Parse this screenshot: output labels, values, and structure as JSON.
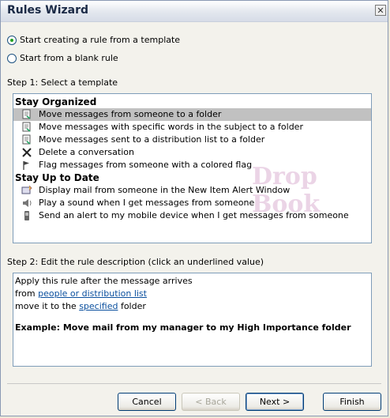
{
  "window": {
    "title": "Rules Wizard",
    "close_glyph": "✕"
  },
  "options": [
    {
      "label": "Start creating a rule from a template",
      "selected": true
    },
    {
      "label": "Start from a blank rule",
      "selected": false
    }
  ],
  "step1": {
    "label": "Step 1: Select a template",
    "groups": [
      {
        "title": "Stay Organized",
        "items": [
          {
            "label": "Move messages from someone to a folder",
            "icon": "folder-move-icon",
            "selected": true
          },
          {
            "label": "Move messages with specific words in the subject to a folder",
            "icon": "folder-move-icon"
          },
          {
            "label": "Move messages sent to a distribution list to a folder",
            "icon": "folder-move-icon"
          },
          {
            "label": "Delete a conversation",
            "icon": "delete-x-icon"
          },
          {
            "label": "Flag messages from someone with a colored flag",
            "icon": "flag-icon"
          }
        ]
      },
      {
        "title": "Stay Up to Date",
        "items": [
          {
            "label": "Display mail from someone in the New Item Alert Window",
            "icon": "alert-window-icon"
          },
          {
            "label": "Play a sound when I get messages from someone",
            "icon": "speaker-icon"
          },
          {
            "label": "Send an alert to my mobile device when I get messages from someone",
            "icon": "mobile-device-icon"
          }
        ]
      }
    ]
  },
  "step2": {
    "label": "Step 2: Edit the rule description (click an underlined value)",
    "line1": "Apply this rule after the message arrives",
    "line2_prefix": "from ",
    "line2_link": "people or distribution list",
    "line3_prefix": "move it to the ",
    "line3_link": "specified",
    "line3_suffix": " folder",
    "example": "Example: Move mail from my manager to my High Importance folder"
  },
  "buttons": {
    "cancel": "Cancel",
    "back": "< Back",
    "next": "Next >",
    "finish": "Finish"
  },
  "watermark": "Drop Book"
}
